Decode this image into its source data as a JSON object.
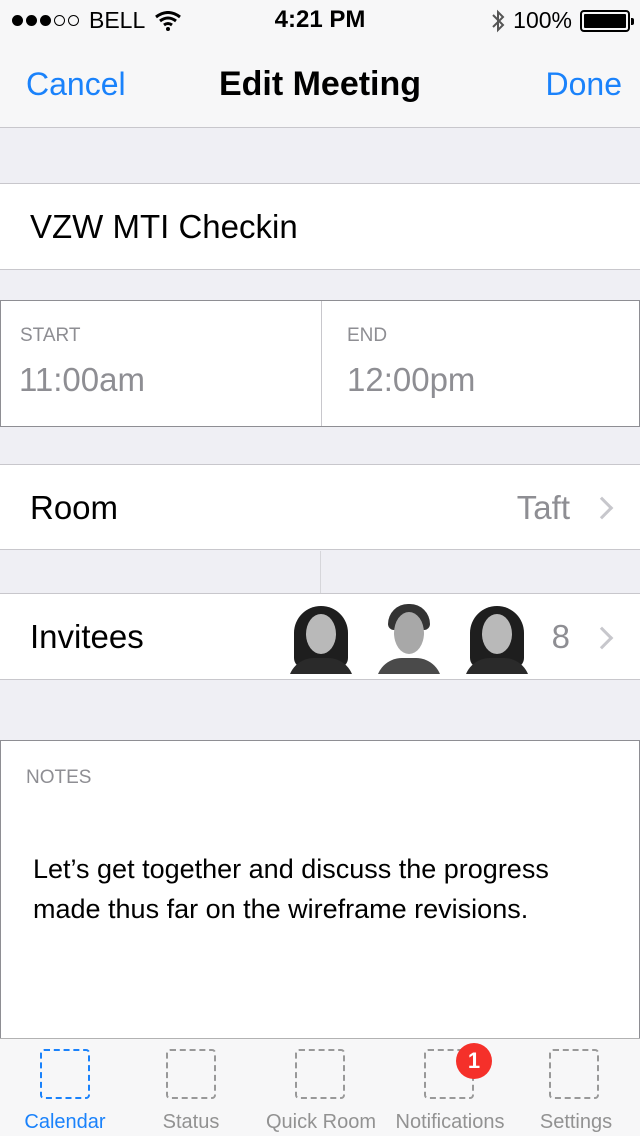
{
  "status_bar": {
    "carrier": "BELL",
    "signal_bars_filled": 3,
    "signal_bars_total": 5,
    "time": "4:21 PM",
    "battery": "100%"
  },
  "nav": {
    "cancel": "Cancel",
    "title": "Edit Meeting",
    "done": "Done"
  },
  "meeting": {
    "title": "VZW MTI Checkin",
    "start_label": "START",
    "start_value": "11:00am",
    "end_label": "END",
    "end_value": "12:00pm",
    "room_label": "Room",
    "room_value": "Taft",
    "invitees_label": "Invitees",
    "invitees_count": "8",
    "notes_label": "NOTES",
    "notes_text": "Let’s get together and discuss the progress made thus far on the wireframe revisions."
  },
  "tab_bar": {
    "tabs": [
      {
        "label": "Calendar",
        "active": true
      },
      {
        "label": "Status",
        "active": false
      },
      {
        "label": "Quick Room",
        "active": false
      },
      {
        "label": "Notifications",
        "active": false,
        "badge": "1"
      },
      {
        "label": "Settings",
        "active": false
      }
    ]
  },
  "colors": {
    "accent": "#1a82fb",
    "badge": "#f5302a",
    "secondary_text": "#8e8e93"
  }
}
